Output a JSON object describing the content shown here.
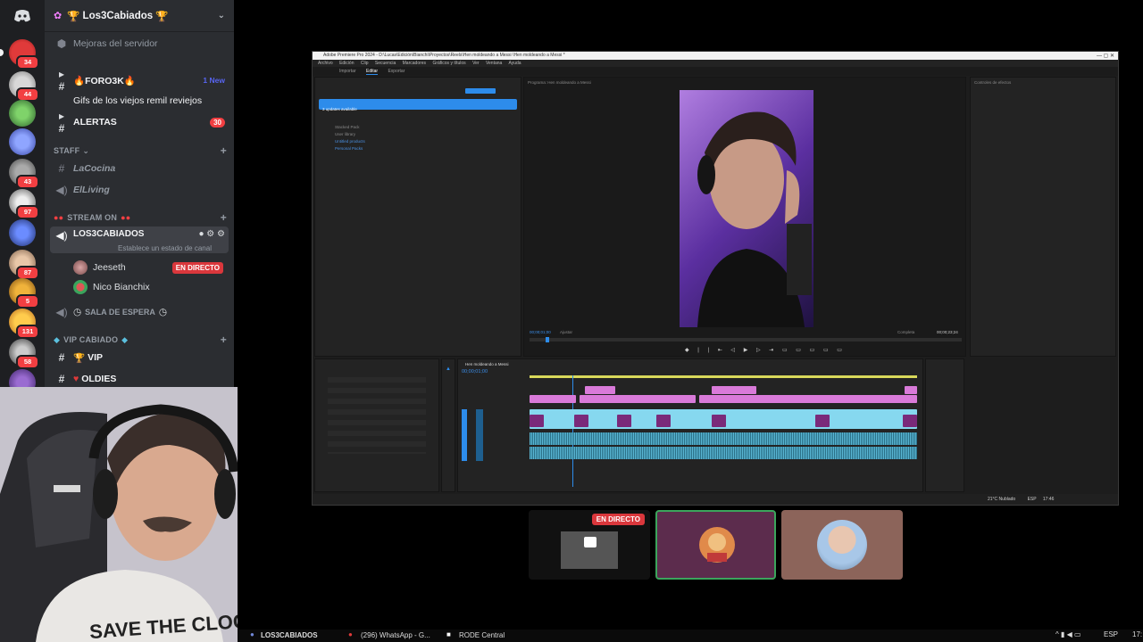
{
  "server": {
    "name": "Los3Cabiados",
    "prefix_emoji": "🏆",
    "suffix_emoji": "🏆"
  },
  "boost": {
    "label": "Mejoras del servidor"
  },
  "channels": {
    "foro": {
      "label": "🔥FORO3K🔥",
      "badge": "1 New"
    },
    "thread": {
      "label": "Gifs de los viejos remil reviejos"
    },
    "alertas": {
      "label": "ALERTAS",
      "badge": "30"
    },
    "staff_cat": {
      "label": "STAFF"
    },
    "cocina": {
      "label": "LaCocina"
    },
    "living": {
      "label": "ElLiving"
    },
    "stream_cat": {
      "label": "STREAM ON"
    },
    "voice_main": {
      "label": "LOS3CABIADOS",
      "status": "Establece un estado de canal"
    },
    "user1": {
      "label": "Jeeseth",
      "live": "EN DIRECTO"
    },
    "user2": {
      "label": "Nico Bianchix"
    },
    "espera": {
      "label": "SALA DE ESPERA"
    },
    "vip_cat": {
      "label": "VIP CABIADO"
    },
    "vip": {
      "label": "VIP"
    },
    "oldies": {
      "label": "OLDIES"
    }
  },
  "rail_badges": [
    "34",
    "44",
    "43",
    "97",
    "87",
    "5",
    "131",
    "58"
  ],
  "premiere": {
    "title": "Adobe Premiere Pro 2024 - D:\\Lucas\\Edición\\Bianchi\\Proyectos\\Reels\\Hen moldeando a Messi \\Hen moldeando a Messi *",
    "menu": [
      "Archivo",
      "Edición",
      "Clip",
      "Secuencia",
      "Marcadores",
      "Gráficos y títulos",
      "Ver",
      "Ventana",
      "Ayuda"
    ],
    "tabs": [
      "Importar",
      "Editar",
      "Exportar"
    ],
    "updates_banner": "3 updates available",
    "program_label": "Programa: Hen moldeando a Messi",
    "timecode_left": "00;00;01;00",
    "timecode_right": "00;00;23;24",
    "fit": "Ajustar",
    "quality": "Completa",
    "sequence_tab": "Hen moldeando a Messi",
    "timeline_tc": "00;00;01;00",
    "bins": [
      "Stacked Pack",
      "User library",
      "Untitled products",
      "Personal Packs"
    ],
    "effects_title": "Controles de efectos",
    "weather": "21°C Nublado",
    "lang": "ESP",
    "clock": "17:46"
  },
  "tiles": {
    "live": "EN DIRECTO"
  },
  "taskbar": {
    "items": [
      "LOS3CABIADOS",
      "(296) WhatsApp - G...",
      "RODE Central"
    ],
    "lang": "ESP",
    "clock": "17:"
  }
}
